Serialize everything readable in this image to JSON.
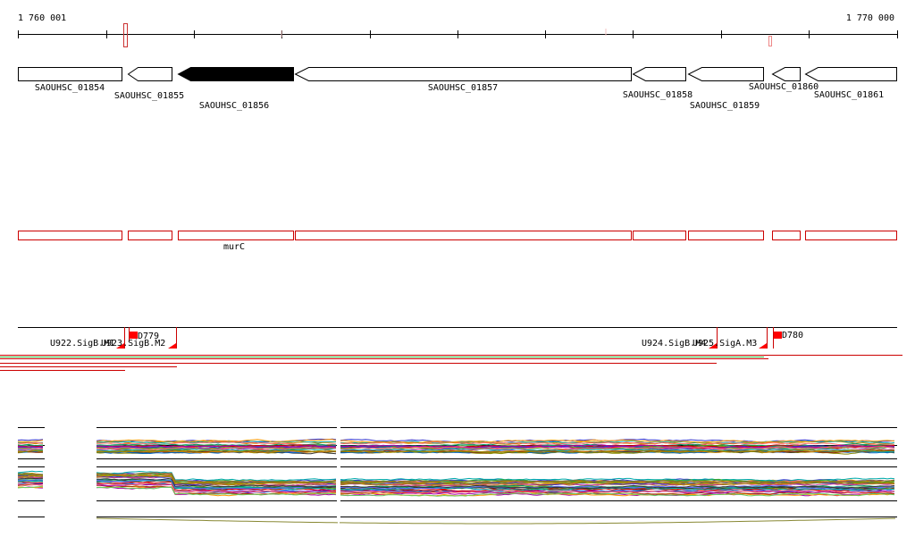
{
  "ruler": {
    "start_label": "1 760 001",
    "end_label": "1 770 000"
  },
  "genes": [
    {
      "name": "SAOUHSC_01854",
      "strand": "+",
      "selected": false
    },
    {
      "name": "SAOUHSC_01855",
      "strand": "-",
      "selected": false
    },
    {
      "name": "SAOUHSC_01856",
      "strand": "-",
      "selected": true
    },
    {
      "name": "SAOUHSC_01857",
      "strand": "-",
      "selected": false
    },
    {
      "name": "SAOUHSC_01858",
      "strand": "-",
      "selected": false
    },
    {
      "name": "SAOUHSC_01859",
      "strand": "-",
      "selected": false
    },
    {
      "name": "SAOUHSC_01860",
      "strand": "-",
      "selected": false
    },
    {
      "name": "SAOUHSC_01861",
      "strand": "-",
      "selected": false
    }
  ],
  "feature_track": {
    "label": "murC"
  },
  "promoters": [
    {
      "name": "U922.SigB.M1"
    },
    {
      "name": "U923.SigB.M2"
    },
    {
      "name": "U924.SigB.M4"
    },
    {
      "name": "U925.SigA.M3"
    }
  ],
  "regulators": [
    {
      "name": "D779"
    },
    {
      "name": "D780"
    }
  ],
  "colors": {
    "selected_gene": "#000000",
    "feature_outline": "#cc0000",
    "marker_fill": "#ff0000",
    "tiling_green": "#33aa33",
    "tiling_red": "#cc0000"
  }
}
